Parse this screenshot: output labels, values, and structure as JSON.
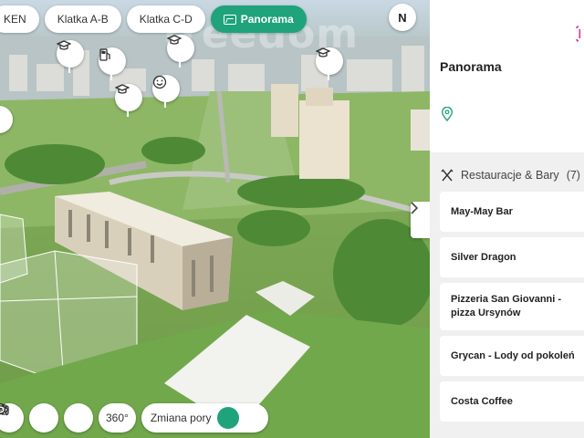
{
  "watermark": "freedom",
  "tabs": [
    {
      "label": "KEN",
      "active": false
    },
    {
      "label": "Klatka A-B",
      "active": false
    },
    {
      "label": "Klatka C-D",
      "active": false
    },
    {
      "label": "Panorama",
      "active": true
    }
  ],
  "compass": {
    "label": "N"
  },
  "map_pins": [
    {
      "icon": "graduation-cap-icon"
    },
    {
      "icon": "fuel-pump-icon"
    },
    {
      "icon": "graduation-cap-icon"
    },
    {
      "icon": "graduation-cap-icon"
    },
    {
      "icon": "smiley-icon"
    },
    {
      "icon": "graduation-cap-icon"
    }
  ],
  "toolbar": {
    "view_label": "360°",
    "time_label": "Zmiana pory"
  },
  "panel": {
    "title": "Panorama",
    "category": {
      "label": "Restauracje & Bary",
      "count": "(7)"
    },
    "places": [
      "May-May Bar",
      "Silver Dragon",
      "Pizzeria San Giovanni - pizza Ursynów",
      "Grycan - Lody od pokoleń",
      "Costa Coffee"
    ]
  },
  "colors": {
    "accent": "#1fa37a",
    "brand": "#d6339a"
  }
}
